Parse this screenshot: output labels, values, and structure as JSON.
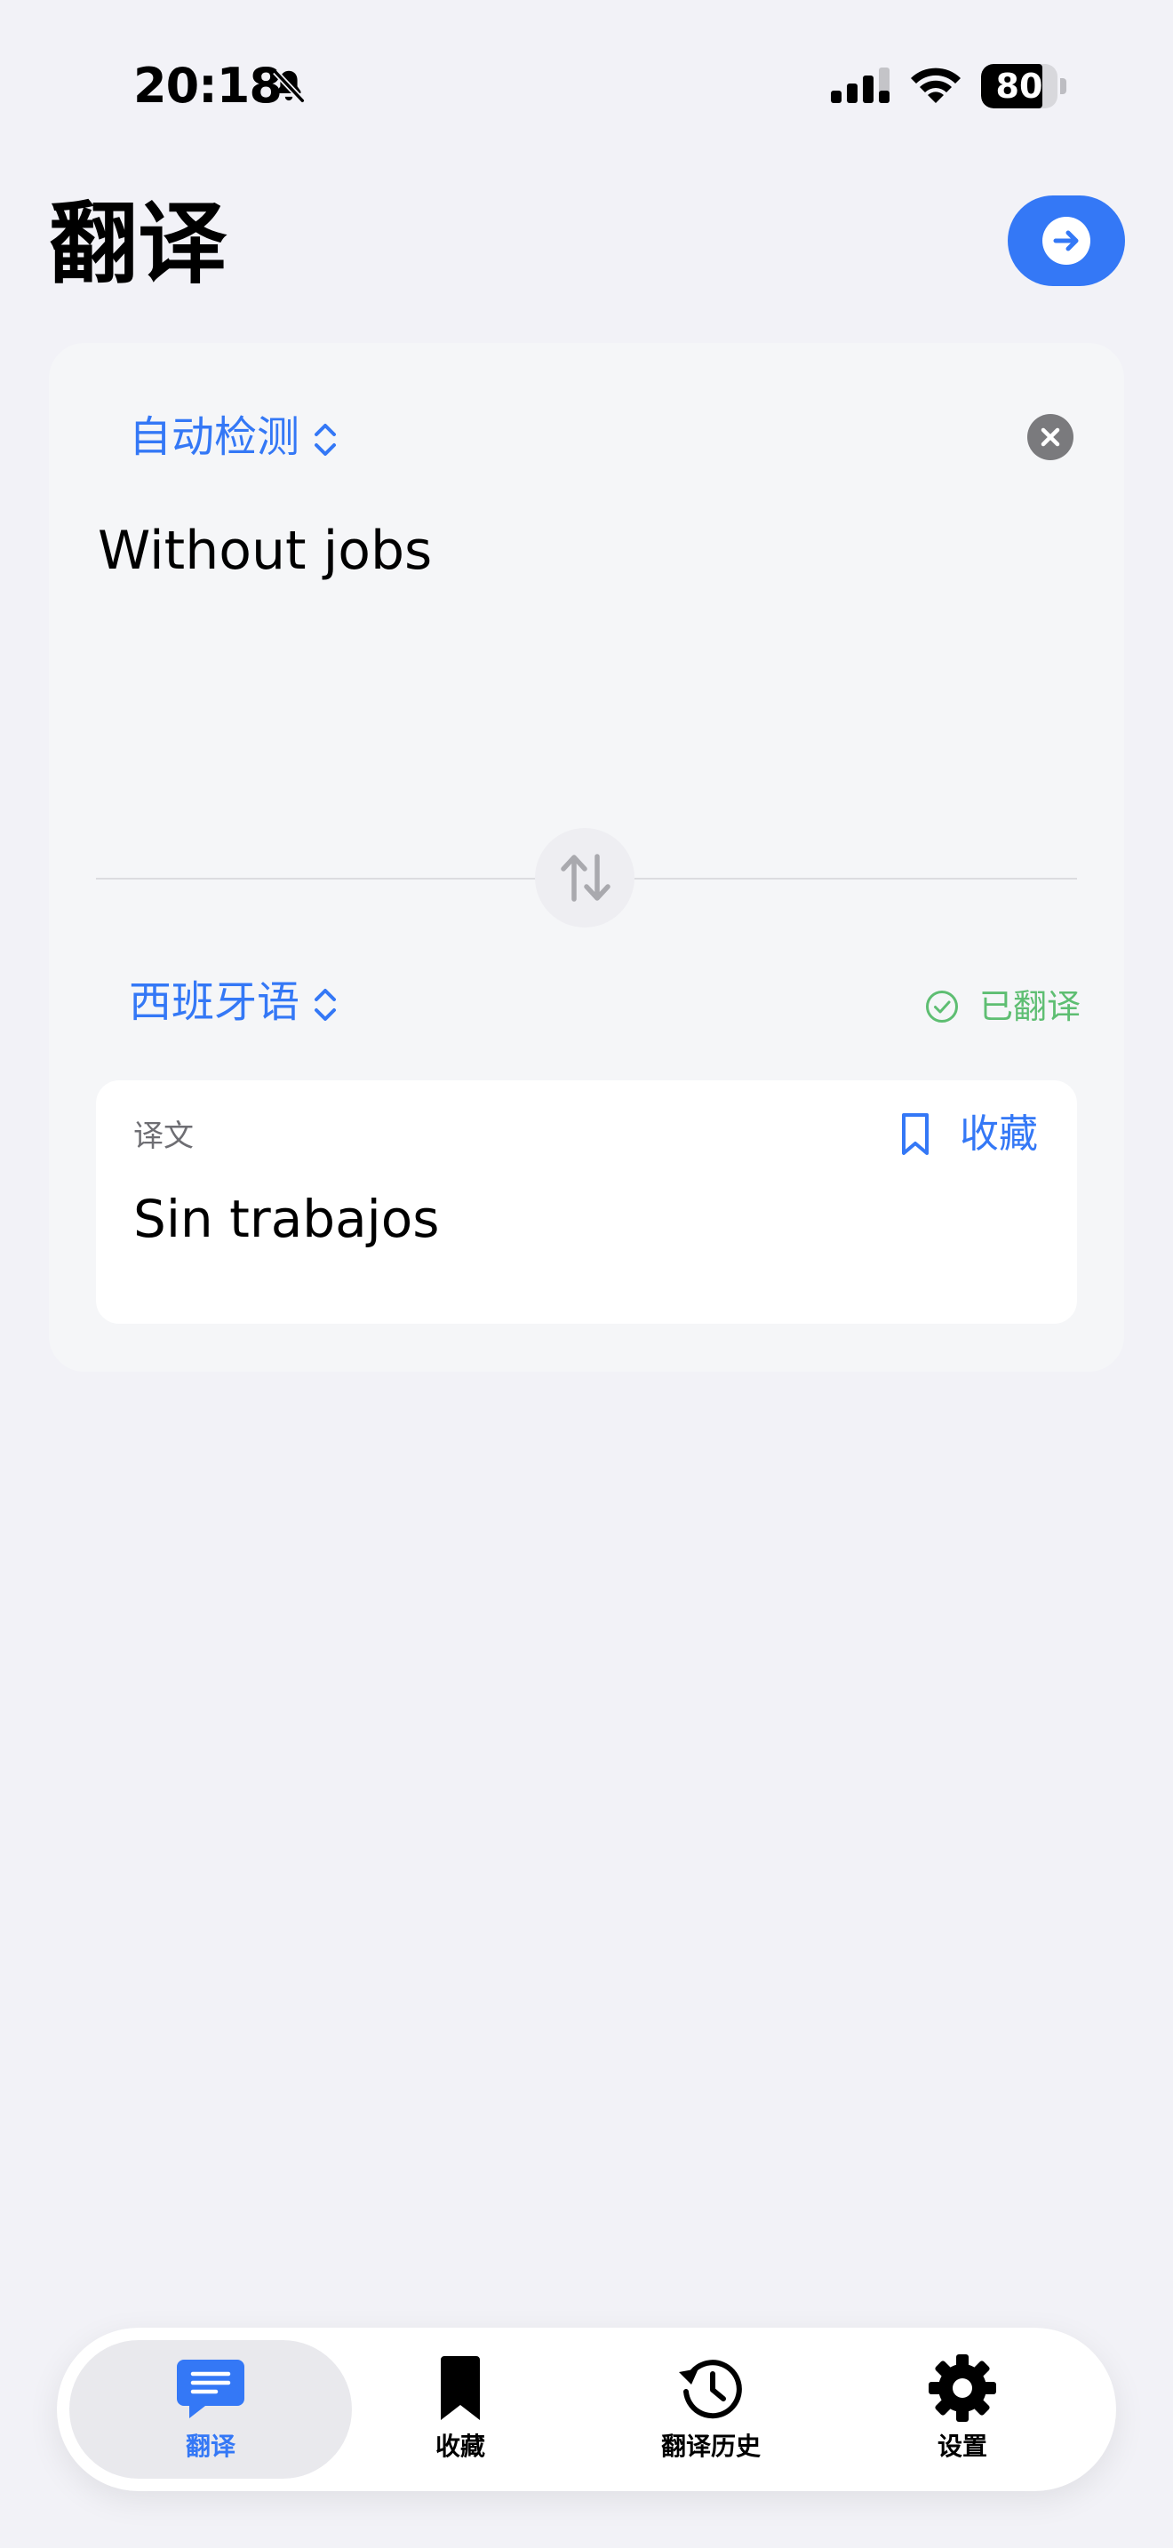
{
  "status_bar": {
    "time": "20:18",
    "battery": "80",
    "battery_level": 0.8
  },
  "header": {
    "title": "翻译"
  },
  "source": {
    "language": "自动检测",
    "text": "Without jobs"
  },
  "target": {
    "language": "西班牙语",
    "status": "已翻译"
  },
  "result": {
    "label": "译文",
    "favorite_label": "收藏",
    "text": "Sin trabajos"
  },
  "tabbar": {
    "tabs": [
      {
        "label": "翻译",
        "icon": "chat-bubble-icon",
        "active": true
      },
      {
        "label": "收藏",
        "icon": "bookmark-icon",
        "active": false
      },
      {
        "label": "翻译历史",
        "icon": "history-clock-icon",
        "active": false
      },
      {
        "label": "设置",
        "icon": "gear-icon",
        "active": false
      }
    ]
  },
  "colors": {
    "accent": "#3478F6",
    "success": "#5EBE72",
    "background": "#F2F2F7"
  }
}
